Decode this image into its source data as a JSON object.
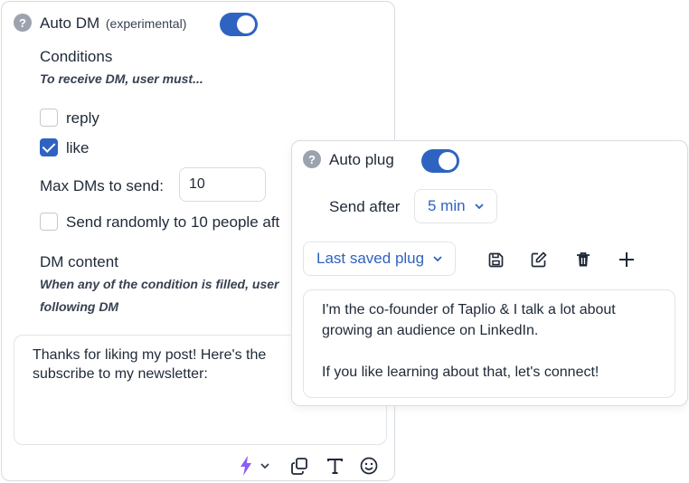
{
  "auto_dm": {
    "help_glyph": "?",
    "title": "Auto DM",
    "title_suffix": "(experimental)",
    "toggle_on": true,
    "conditions_label": "Conditions",
    "conditions_hint": "To receive DM, user must...",
    "conditions": [
      {
        "label": "reply",
        "checked": false
      },
      {
        "label": "like",
        "checked": true
      }
    ],
    "max_dms_label": "Max DMs to send:",
    "max_dms_value": "10",
    "random_label": "Send randomly to 10 people aft",
    "random_checked": false,
    "dm_content_label": "DM content",
    "dm_content_hint_1": "When any of the condition is filled, user",
    "dm_content_hint_2": "following DM",
    "dm_message": "Thanks for liking my post! Here's the\nsubscribe to my newsletter:",
    "toolbar_icons": [
      "lightning-icon",
      "chevron-down-icon",
      "copy-icon",
      "text-format-icon",
      "emoji-icon"
    ]
  },
  "auto_plug": {
    "help_glyph": "?",
    "title": "Auto plug",
    "toggle_on": true,
    "send_after_label": "Send after",
    "send_after_value": "5 min",
    "plug_select_value": "Last saved plug",
    "toolbar_icons": [
      "save-icon",
      "edit-icon",
      "trash-icon",
      "plus-icon"
    ],
    "message": "I'm the co-founder of Taplio & I talk a lot about\ngrowing an audience on LinkedIn.\n\nIf you like learning about that, let's connect!"
  },
  "colors": {
    "accent": "#2f63c1",
    "lightning": "#8b5cf6",
    "help_badge": "#9ca3af",
    "border": "#d8dbe0"
  }
}
